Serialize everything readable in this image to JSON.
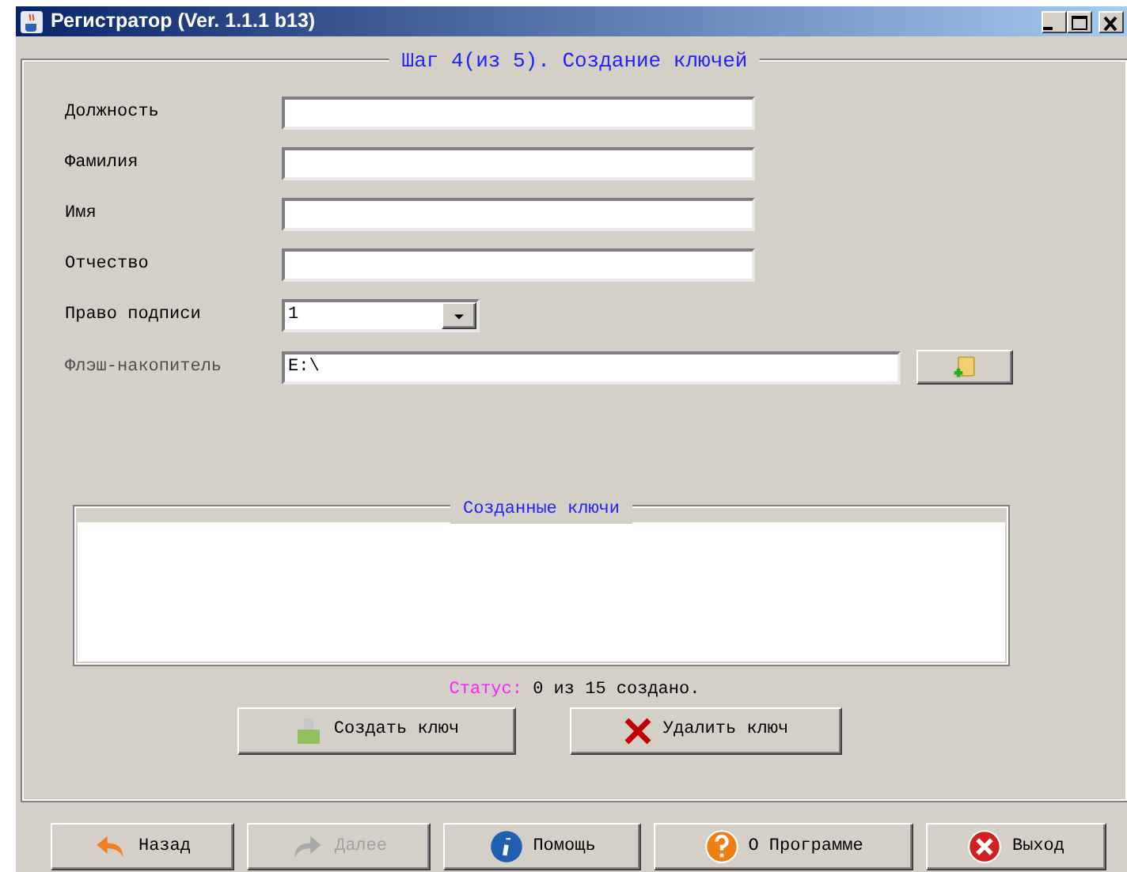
{
  "window": {
    "title": "Регистратор  (Ver. 1.1.1 b13)"
  },
  "step_title": "Шаг 4(из 5). Создание ключей",
  "fields": [
    {
      "kind": "text",
      "label": "Должность"
    },
    {
      "kind": "text",
      "label": "Фамилия"
    },
    {
      "kind": "text",
      "label": "Имя"
    },
    {
      "kind": "text",
      "label": "Отчество"
    },
    {
      "kind": "combo",
      "label": "Право подписи",
      "value": "1"
    },
    {
      "kind": "path",
      "label": "Флэш-накопитель",
      "value": "E:\\"
    }
  ],
  "keys_panel": {
    "title": "Созданные ключи"
  },
  "status": {
    "label": "Статус:",
    "text": "0 из 15 создано."
  },
  "actions": [
    {
      "label": "Создать ключ"
    },
    {
      "label": "Удалить ключ"
    }
  ],
  "nav_buttons": [
    {
      "label": "Назад",
      "disabled": false
    },
    {
      "label": "Далее",
      "disabled": true
    },
    {
      "label": "Помощь",
      "disabled": false
    },
    {
      "label": "О Программе",
      "disabled": false
    },
    {
      "label": "Выход",
      "disabled": false
    }
  ]
}
